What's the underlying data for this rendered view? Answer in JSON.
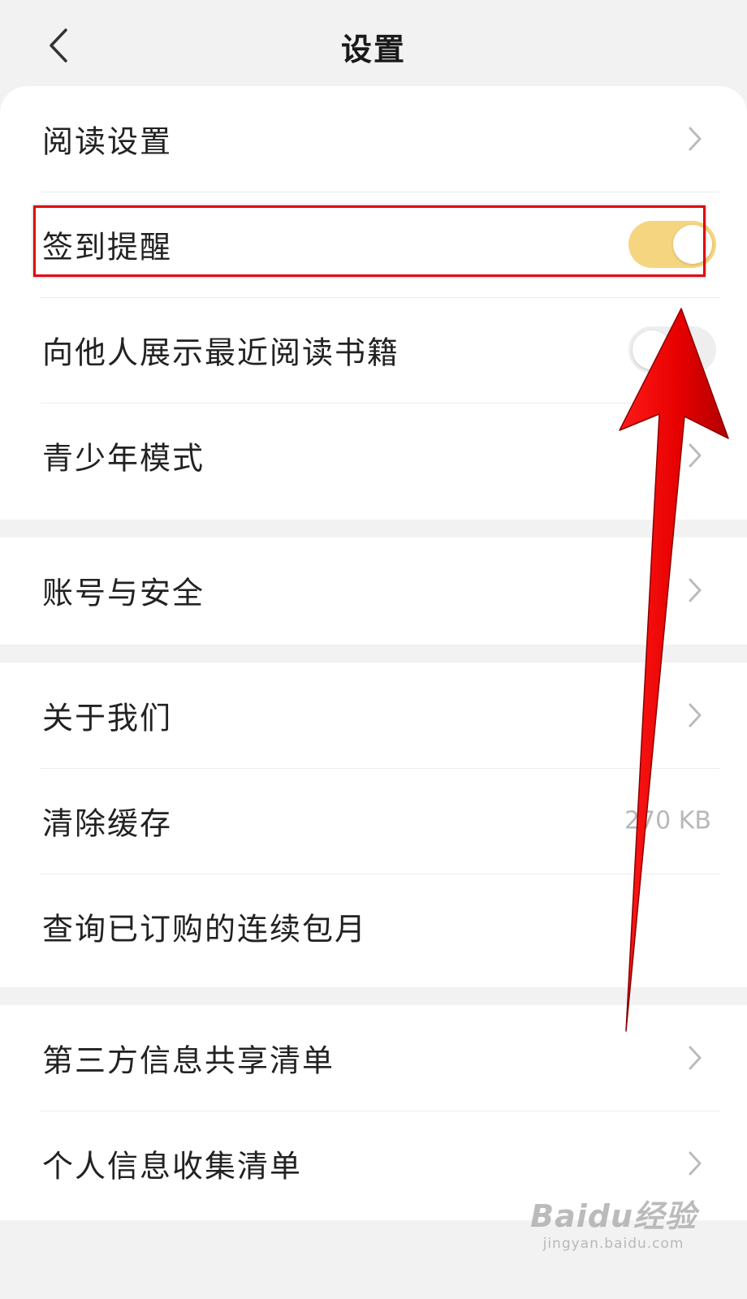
{
  "header": {
    "title": "设置"
  },
  "sections": [
    {
      "items": [
        {
          "label": "阅读设置",
          "control": "chevron"
        },
        {
          "label": "签到提醒",
          "control": "toggle",
          "on": true
        },
        {
          "label": "向他人展示最近阅读书籍",
          "control": "toggle",
          "on": false
        },
        {
          "label": "青少年模式",
          "control": "chevron"
        }
      ]
    },
    {
      "items": [
        {
          "label": "账号与安全",
          "control": "chevron"
        }
      ]
    },
    {
      "items": [
        {
          "label": "关于我们",
          "control": "chevron"
        },
        {
          "label": "清除缓存",
          "control": "value",
          "value": "270 KB"
        },
        {
          "label": "查询已订购的连续包月",
          "control": "none"
        }
      ]
    },
    {
      "items": [
        {
          "label": "第三方信息共享清单",
          "control": "chevron"
        },
        {
          "label": "个人信息收集清单",
          "control": "chevron"
        }
      ]
    }
  ],
  "watermark": {
    "brand": "Baidu经验",
    "url": "jingyan.baidu.com"
  },
  "colors": {
    "toggle_on": "#f5d57f",
    "toggle_off": "#eeeeee",
    "annotation": "#e30012"
  },
  "icons": [
    "back-arrow-icon",
    "chevron-right-icon",
    "red-arrow-annotation"
  ]
}
